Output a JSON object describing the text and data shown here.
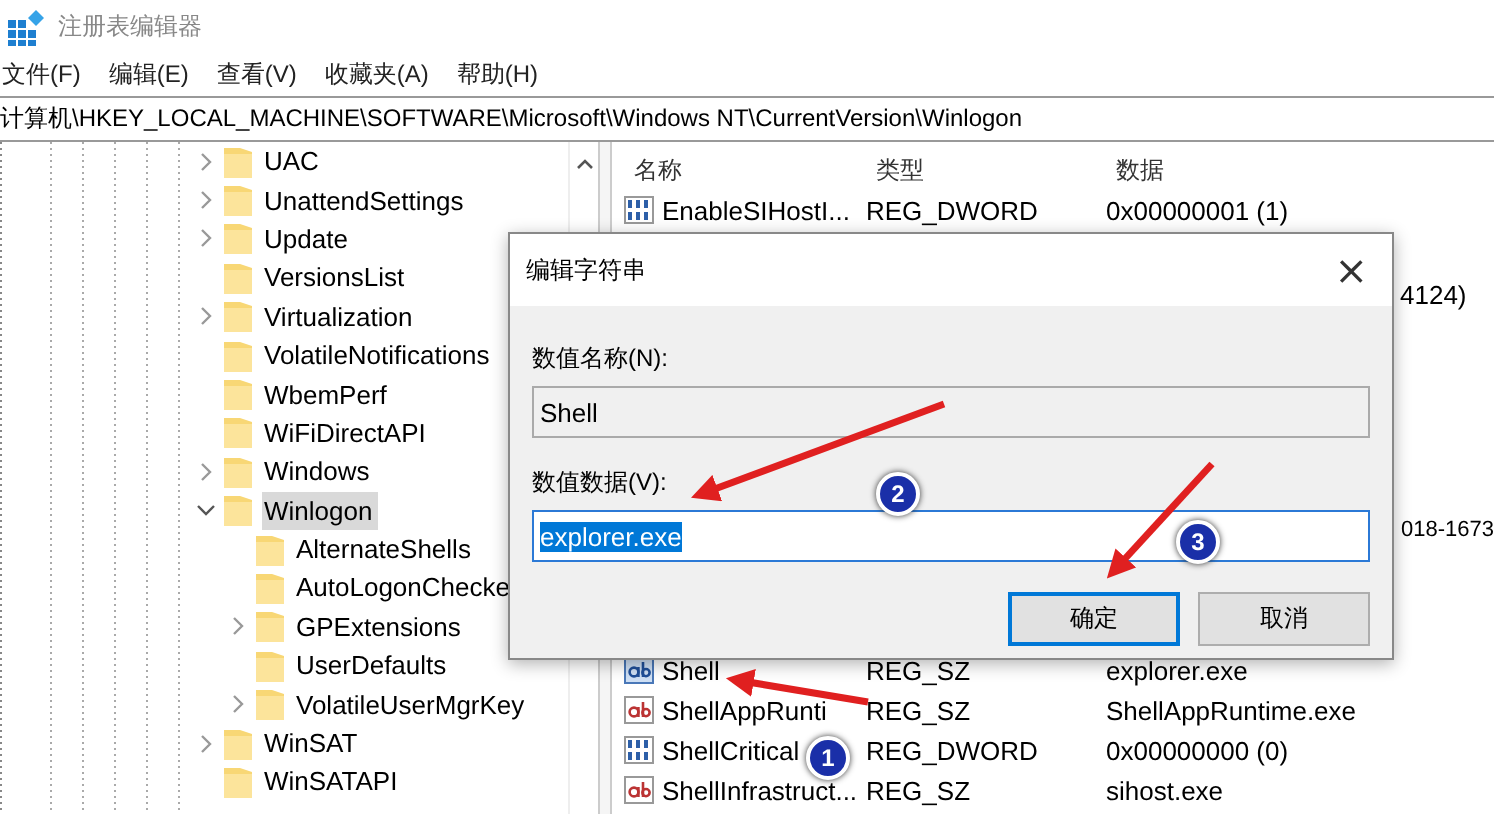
{
  "window": {
    "title": "注册表编辑器"
  },
  "menu": [
    "文件(F)",
    "编辑(E)",
    "查看(V)",
    "收藏夹(A)",
    "帮助(H)"
  ],
  "address": "计算机\\HKEY_LOCAL_MACHINE\\SOFTWARE\\Microsoft\\Windows NT\\CurrentVersion\\Winlogon",
  "tree": [
    {
      "label": "UAC",
      "expanded": false,
      "selected": false
    },
    {
      "label": "UnattendSettings",
      "expanded": false,
      "selected": false
    },
    {
      "label": "Update",
      "expanded": false,
      "selected": false
    },
    {
      "label": "VersionsList",
      "selected": false
    },
    {
      "label": "Virtualization",
      "expanded": false,
      "selected": false
    },
    {
      "label": "VolatileNotifications",
      "selected": false
    },
    {
      "label": "WbemPerf",
      "selected": false
    },
    {
      "label": "WiFiDirectAPI",
      "selected": false
    },
    {
      "label": "Windows",
      "expanded": false,
      "selected": false
    },
    {
      "label": "Winlogon",
      "expanded": true,
      "selected": true,
      "children": [
        {
          "label": "AlternateShells",
          "selected": false
        },
        {
          "label": "AutoLogonChecke",
          "selected": false
        },
        {
          "label": "GPExtensions",
          "expanded": false,
          "selected": false
        },
        {
          "label": "UserDefaults",
          "selected": false
        },
        {
          "label": "VolatileUserMgrKey",
          "expanded": false,
          "selected": false
        }
      ]
    },
    {
      "label": "WinSAT",
      "expanded": false,
      "selected": false
    },
    {
      "label": "WinSATAPI",
      "selected": false
    }
  ],
  "values": {
    "columns": [
      "名称",
      "类型",
      "数据"
    ],
    "rows": [
      {
        "kind": "binary",
        "name": "EnableSIHostI...",
        "type": "REG_DWORD",
        "data": "0x00000001 (1)",
        "selected": false
      },
      {
        "kind": "fragment",
        "data": "4124)",
        "selected": false
      },
      {
        "kind": "fragment",
        "data": "018-1673",
        "selected": false
      },
      {
        "kind": "string",
        "name": "Shell",
        "type": "REG_SZ",
        "data": "explorer.exe",
        "selected": true
      },
      {
        "kind": "string",
        "name": "ShellAppRunti",
        "type": "REG_SZ",
        "data": "ShellAppRuntime.exe",
        "selected": false
      },
      {
        "kind": "binary",
        "name": "ShellCritical",
        "type": "REG_DWORD",
        "data": "0x00000000 (0)",
        "selected": false
      },
      {
        "kind": "string",
        "name": "ShellInfrastruct...",
        "type": "REG_SZ",
        "data": "sihost.exe",
        "selected": false
      }
    ]
  },
  "dialog": {
    "title": "编辑字符串",
    "close": "×",
    "name_label": "数值名称(N):",
    "name_value": "Shell",
    "data_label": "数值数据(V):",
    "data_value": "explorer.exe",
    "buttons": [
      {
        "label": "确定",
        "default": true
      },
      {
        "label": "取消",
        "default": false
      }
    ]
  },
  "annotations": [
    {
      "number": "1"
    },
    {
      "number": "2"
    },
    {
      "number": "3"
    }
  ]
}
